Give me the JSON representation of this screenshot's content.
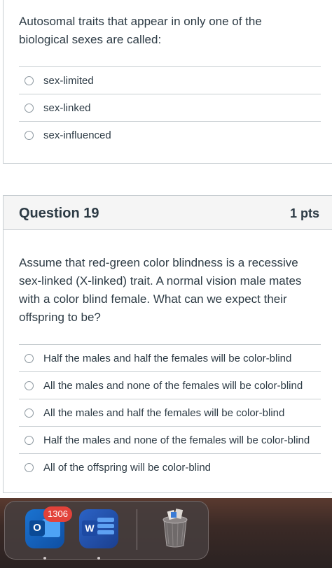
{
  "question18": {
    "text": "Autosomal traits that appear in only one of the biological sexes are called:",
    "answers": [
      "sex-limited",
      "sex-linked",
      "sex-influenced"
    ]
  },
  "question19": {
    "title": "Question 19",
    "points": "1 pts",
    "text": "Assume that red-green color blindness is a recessive sex-linked (X-linked) trait.  A normal vision male mates with a color blind female.  What can we expect their offspring to be?",
    "answers": [
      "Half the males and half the females will be color-blind",
      "All the males and none of the females will be color-blind",
      "All the males and half the females will be color-blind",
      "Half the males and none of the females will be color-blind",
      "All of the offspring will be color-blind"
    ]
  },
  "dock": {
    "outlook_badge": "1306",
    "outlook_letter": "O",
    "word_letter": "W",
    "icons": [
      "outlook-icon",
      "word-icon",
      "trash-icon"
    ]
  },
  "colors": {
    "text": "#2d3b45",
    "border": "#c7cdd1",
    "header_bg": "#f5f5f5",
    "badge": "#e2423a"
  }
}
